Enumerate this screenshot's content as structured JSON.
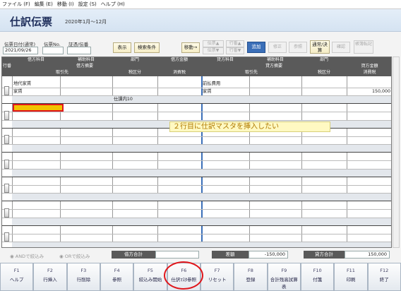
{
  "menu": [
    "ファイル (F)",
    "編集 (E)",
    "移動 (I)",
    "設定 (S)",
    "ヘルプ (H)"
  ],
  "title": "仕訳伝票",
  "period": "2020年1月～12月",
  "form": {
    "date_label": "伝票日付(通常)",
    "date_value": "2021/09/26",
    "no_label": "伝票No.",
    "cert_label": "証憑/伝番"
  },
  "toolbar": {
    "display": "表示",
    "search": "検索条件",
    "move": "移動→",
    "prev_slip": "伝票▲",
    "next_slip": "伝票▼",
    "row_up": "行番▲",
    "row_down": "行番▼",
    "add": "追加",
    "edit": "修正",
    "ref": "参照",
    "normal_close": "通常/決算",
    "confirm": "確認",
    "book": "帳簿転記"
  },
  "grid": {
    "row_num_header": "行番",
    "debit_headers": [
      "借方科目",
      "補助科目",
      "部門"
    ],
    "debit_summary_header": "借方摘要",
    "debit_amount_header": "借方金額",
    "partner_header": "取引先",
    "tax_div_header": "税区分",
    "tax_header": "消費税",
    "credit_headers": [
      "貸方科目",
      "補助科目",
      "部門"
    ],
    "credit_summary_header": "貸方摘要",
    "credit_amount_header": "貸方金額",
    "row1": {
      "debit_account": "地代家賃",
      "debit_summary": "家賃",
      "debit_tax_div": "仕課内10",
      "credit_account": "前払費用",
      "credit_summary": "家賃",
      "credit_amount": "150,000"
    }
  },
  "annotation": "２行目に仕訳マスタを挿入したい",
  "footer": {
    "and_label": "ANDで絞込み",
    "or_label": "ORで絞込み",
    "debit_total_label": "借方合計",
    "diff_label": "差額",
    "diff_value": "-150,000",
    "credit_total_label": "貸方合計",
    "credit_total_value": "150,000"
  },
  "fkeys": [
    {
      "key": "F1",
      "label": "ヘルプ"
    },
    {
      "key": "F2",
      "label": "行挿入"
    },
    {
      "key": "F3",
      "label": "行削除"
    },
    {
      "key": "F4",
      "label": "参照"
    },
    {
      "key": "F5",
      "label": "絞込み開始"
    },
    {
      "key": "F6",
      "label": "仕訳ﾏｽﾀ参照"
    },
    {
      "key": "F7",
      "label": "リセット"
    },
    {
      "key": "F8",
      "label": "登録"
    },
    {
      "key": "F9",
      "label": "合計残高試算表"
    },
    {
      "key": "F10",
      "label": "付箋"
    },
    {
      "key": "F11",
      "label": "印刷"
    },
    {
      "key": "F12",
      "label": "終了"
    }
  ],
  "colors": {
    "accent": "#3b6fb8",
    "highlight": "#f2c200",
    "annotation_bg": "#fff9c2",
    "circle": "#e0161b"
  }
}
